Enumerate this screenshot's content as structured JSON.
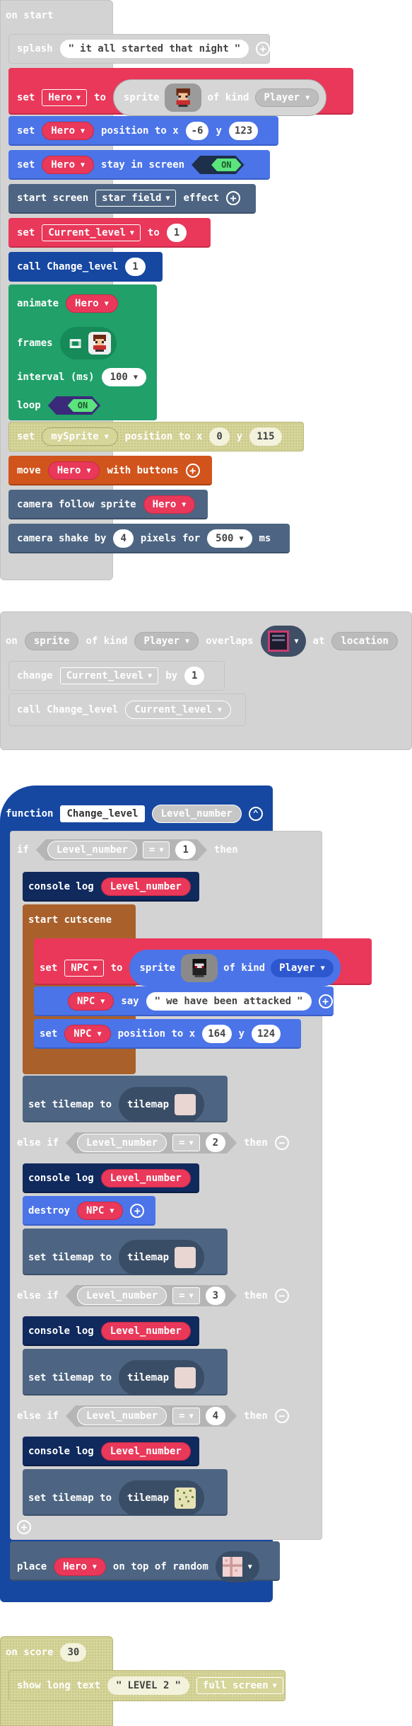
{
  "on_start": {
    "label": "on start",
    "splash": {
      "label": "splash",
      "text": "it all started that night"
    },
    "set_hero": {
      "set": "set",
      "var": "Hero",
      "to": "to",
      "sprite": "sprite",
      "of_kind": "of kind",
      "kind": "Player"
    },
    "position": {
      "set": "set",
      "var": "Hero",
      "position": "position to x",
      "x": "-6",
      "y_label": "y",
      "y": "123"
    },
    "stay": {
      "set": "set",
      "var": "Hero",
      "label": "stay in screen",
      "toggle": "ON"
    },
    "start_screen": {
      "label": "start screen",
      "effect_name": "star field",
      "effect": "effect"
    },
    "set_level": {
      "set": "set",
      "var": "Current_level",
      "to": "to",
      "value": "1"
    },
    "call": {
      "label": "call Change_level",
      "arg": "1"
    },
    "animate": {
      "label": "animate",
      "var": "Hero",
      "frames": "frames",
      "interval": "interval (ms)",
      "interval_value": "100",
      "loop": "loop",
      "loop_toggle": "ON"
    },
    "set_my": {
      "set": "set",
      "var": "mySprite",
      "position": "position to x",
      "x": "0",
      "y_label": "y",
      "y": "115"
    },
    "move": {
      "label": "move",
      "var": "Hero",
      "with": "with buttons"
    },
    "camera_follow": {
      "label": "camera follow sprite",
      "var": "Hero"
    },
    "camera_shake": {
      "label": "camera shake by",
      "value": "4",
      "pixels": "pixels for",
      "ms_value": "500",
      "ms": "ms"
    }
  },
  "overlap": {
    "on": "on",
    "sprite": "sprite",
    "of_kind": "of kind",
    "kind": "Player",
    "overlaps": "overlaps",
    "at": "at",
    "location": "location",
    "change": {
      "label": "change",
      "var": "Current_level",
      "by": "by",
      "value": "1"
    },
    "call": {
      "label": "call Change_level",
      "arg": "Current_level"
    }
  },
  "function": {
    "label": "function",
    "name": "Change_level",
    "param": "Level_number",
    "if": "if",
    "then": "then",
    "else_if": "else if",
    "eq": "=",
    "cond1_value": "1",
    "cond2_value": "2",
    "cond3_value": "3",
    "cond4_value": "4",
    "console_log": "console log",
    "var": "Level_number",
    "cutscene": "start cutscene",
    "set_npc": {
      "set": "set",
      "var": "NPC",
      "to": "to",
      "sprite": "sprite",
      "of_kind": "of kind",
      "kind": "Player"
    },
    "say": {
      "var": "NPC",
      "say": "say",
      "text": "we have been attacked"
    },
    "npc_pos": {
      "set": "set",
      "var": "NPC",
      "position": "position to x",
      "x": "164",
      "y_label": "y",
      "y": "124"
    },
    "set_tilemap": "set tilemap to",
    "tilemap": "tilemap",
    "destroy": {
      "label": "destroy",
      "var": "NPC"
    },
    "place": {
      "label": "place",
      "var": "Hero",
      "on_top": "on top of random"
    }
  },
  "on_score": {
    "label": "on score",
    "value": "30",
    "show": {
      "label": "show long text",
      "text": "LEVEL 2",
      "mode": "full screen"
    }
  },
  "colors": {
    "red": "#e9385a",
    "blue": "#4b74e8",
    "slate": "#4d6582",
    "navy": "#1647a1",
    "green": "#21a06a",
    "orange": "#d1541c",
    "brown": "#a9602b",
    "olive": "#d6d59a",
    "grey": "#d3d3d3"
  }
}
